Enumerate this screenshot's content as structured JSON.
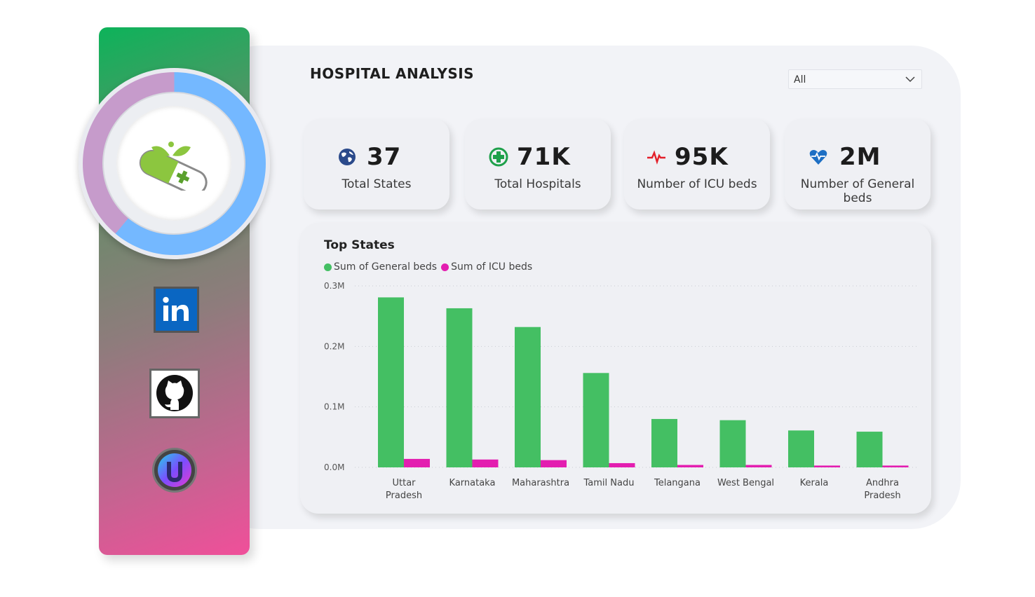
{
  "header": {
    "title": "HOSPITAL ANALYSIS"
  },
  "filter": {
    "selected": "All"
  },
  "kpis": [
    {
      "value": "37",
      "label": "Total States",
      "icon": "globe-icon"
    },
    {
      "value": "71K",
      "label": "Total Hospitals",
      "icon": "plus-circle-icon"
    },
    {
      "value": "95K",
      "label": "Number of ICU beds",
      "icon": "heartbeat-icon"
    },
    {
      "value": "2M",
      "label": "Number of General beds",
      "icon": "heart-pulse-icon"
    }
  ],
  "sidebar": {
    "logo": "capsule-leaf-logo",
    "links": [
      {
        "icon": "linkedin-icon"
      },
      {
        "icon": "github-icon"
      },
      {
        "icon": "portfolio-icon"
      }
    ]
  },
  "colors": {
    "general": "#44bf63",
    "icu": "#e31eb0",
    "accent_blue": "#74b8ff",
    "accent_purple": "#c69bcb"
  },
  "chart_data": {
    "type": "bar",
    "title": "Top States",
    "categories": [
      "Uttar Pradesh",
      "Karnataka",
      "Maharashtra",
      "Tamil Nadu",
      "Telangana",
      "West Bengal",
      "Kerala",
      "Andhra Pradesh"
    ],
    "series": [
      {
        "name": "Sum of General beds",
        "values": [
          281000,
          263000,
          232000,
          156000,
          80000,
          78000,
          61000,
          59000
        ]
      },
      {
        "name": "Sum of ICU beds",
        "values": [
          14000,
          13000,
          12000,
          7000,
          4000,
          4000,
          3000,
          3000
        ]
      }
    ],
    "yticks": [
      "0.0M",
      "0.1M",
      "0.2M",
      "0.3M"
    ],
    "ylim": [
      0,
      300000
    ],
    "grid": true,
    "legend": "top-left"
  }
}
